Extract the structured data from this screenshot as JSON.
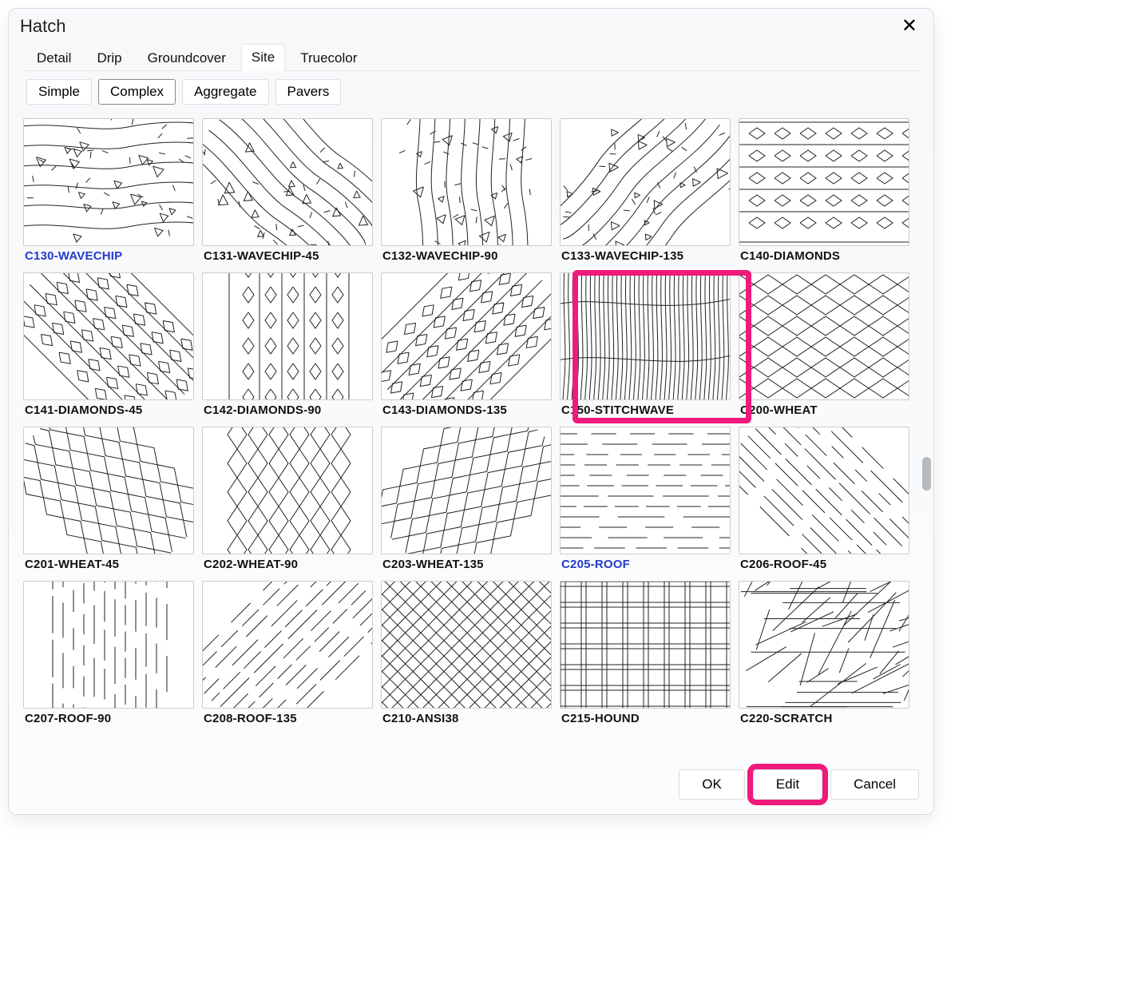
{
  "window": {
    "title": "Hatch"
  },
  "tabs": {
    "items": [
      "Detail",
      "Drip",
      "Groundcover",
      "Site",
      "Truecolor"
    ],
    "active": "Site"
  },
  "subtabs": {
    "items": [
      "Simple",
      "Complex",
      "Aggregate",
      "Pavers"
    ],
    "active": "Complex"
  },
  "patterns": [
    {
      "id": "C130-WAVECHIP",
      "label": "C130-WAVECHIP",
      "selected": true,
      "kind": "wavechip"
    },
    {
      "id": "C131-WAVECHIP-45",
      "label": "C131-WAVECHIP-45",
      "selected": false,
      "kind": "wavechip45"
    },
    {
      "id": "C132-WAVECHIP-90",
      "label": "C132-WAVECHIP-90",
      "selected": false,
      "kind": "wavechip90"
    },
    {
      "id": "C133-WAVECHIP-135",
      "label": "C133-WAVECHIP-135",
      "selected": false,
      "kind": "wavechip135"
    },
    {
      "id": "C140-DIAMONDS",
      "label": "C140-DIAMONDS",
      "selected": false,
      "kind": "diamonds"
    },
    {
      "id": "C141-DIAMONDS-45",
      "label": "C141-DIAMONDS-45",
      "selected": false,
      "kind": "diamonds45"
    },
    {
      "id": "C142-DIAMONDS-90",
      "label": "C142-DIAMONDS-90",
      "selected": false,
      "kind": "diamonds90"
    },
    {
      "id": "C143-DIAMONDS-135",
      "label": "C143-DIAMONDS-135",
      "selected": false,
      "kind": "diamonds135"
    },
    {
      "id": "C150-STITCHWAVE",
      "label": "C150-STITCHWAVE",
      "selected": false,
      "kind": "stitchwave",
      "callout": true
    },
    {
      "id": "C200-WHEAT",
      "label": "C200-WHEAT",
      "selected": false,
      "kind": "wheat"
    },
    {
      "id": "C201-WHEAT-45",
      "label": "C201-WHEAT-45",
      "selected": false,
      "kind": "wheat45"
    },
    {
      "id": "C202-WHEAT-90",
      "label": "C202-WHEAT-90",
      "selected": false,
      "kind": "wheat90"
    },
    {
      "id": "C203-WHEAT-135",
      "label": "C203-WHEAT-135",
      "selected": false,
      "kind": "wheat135"
    },
    {
      "id": "C205-ROOF",
      "label": "C205-ROOF",
      "selected": true,
      "kind": "roof"
    },
    {
      "id": "C206-ROOF-45",
      "label": "C206-ROOF-45",
      "selected": false,
      "kind": "roof45"
    },
    {
      "id": "C207-ROOF-90",
      "label": "C207-ROOF-90",
      "selected": false,
      "kind": "roof90"
    },
    {
      "id": "C208-ROOF-135",
      "label": "C208-ROOF-135",
      "selected": false,
      "kind": "roof135"
    },
    {
      "id": "C210-ANSI38",
      "label": "C210-ANSI38",
      "selected": false,
      "kind": "ansi38"
    },
    {
      "id": "C215-HOUND",
      "label": "C215-HOUND",
      "selected": false,
      "kind": "hound"
    },
    {
      "id": "C220-SCRATCH",
      "label": "C220-SCRATCH",
      "selected": false,
      "kind": "scratch"
    }
  ],
  "footer": {
    "ok": "OK",
    "edit": "Edit",
    "cancel": "Cancel"
  }
}
